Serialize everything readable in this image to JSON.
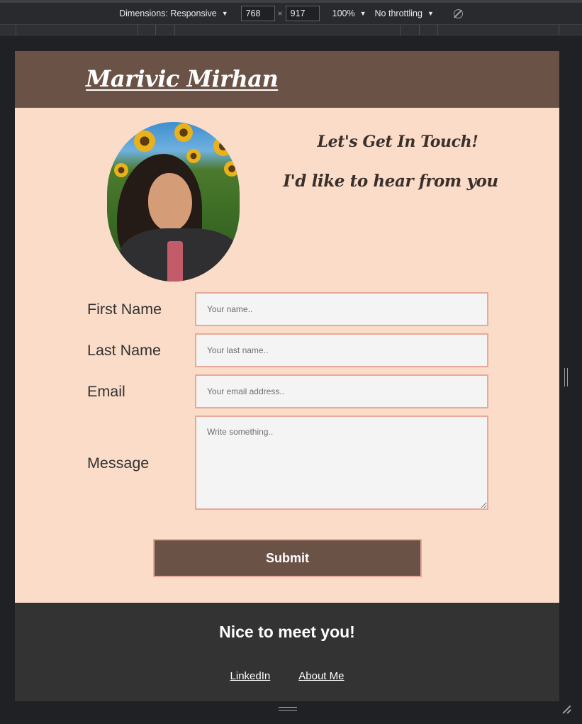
{
  "devtools": {
    "dimensions_label": "Dimensions: Responsive",
    "width": "768",
    "height": "917",
    "zoom": "100%",
    "throttling": "No throttling",
    "times": "×"
  },
  "site": {
    "brand": "Marivic Mirhan",
    "heading_1": "Let's Get In Touch!",
    "heading_2": "I'd like to hear from you"
  },
  "form": {
    "first_name_label": "First Name",
    "first_name_placeholder": "Your name..",
    "last_name_label": "Last Name",
    "last_name_placeholder": "Your last name..",
    "email_label": "Email",
    "email_placeholder": "Your email address..",
    "message_label": "Message",
    "message_placeholder": "Write something..",
    "submit_label": "Submit"
  },
  "footer": {
    "tagline": "Nice to meet you!",
    "links": [
      "LinkedIn",
      "About Me"
    ]
  },
  "colors": {
    "header": "#6b5246",
    "page_bg": "#fadcc8",
    "field_border": "#e8a89a",
    "footer": "#333333"
  }
}
